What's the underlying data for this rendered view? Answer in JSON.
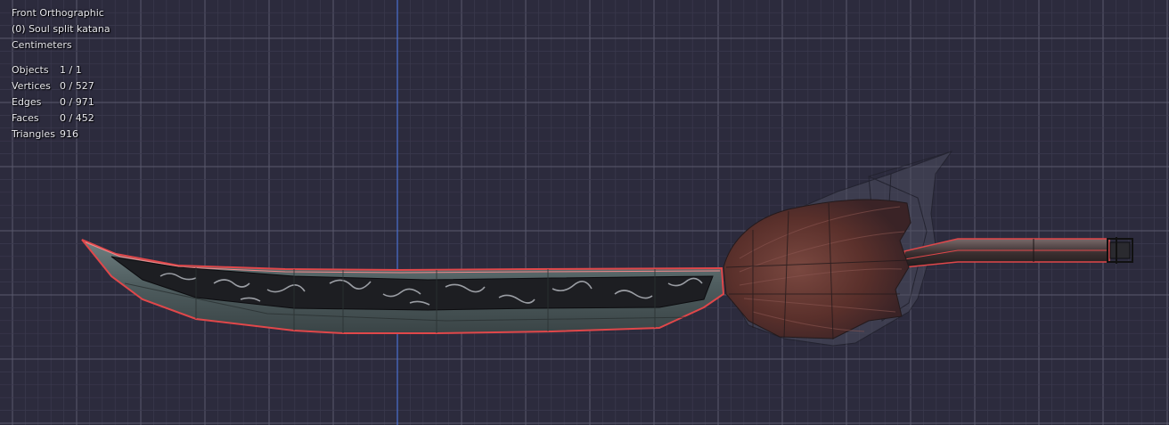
{
  "viewport": {
    "view_name": "Front Orthographic",
    "object_name": "(0) Soul split katana",
    "units": "Centimeters"
  },
  "stats": [
    {
      "label": "Objects",
      "value": "1 / 1"
    },
    {
      "label": "Vertices",
      "value": "0 / 527"
    },
    {
      "label": "Edges",
      "value": "0 / 971"
    },
    {
      "label": "Faces",
      "value": "0 / 452"
    },
    {
      "label": "Triangles",
      "value": "916"
    }
  ],
  "colors": {
    "background": "#2c2b3d",
    "grid_minor": "#3b3a4e",
    "grid_major": "#5a596d",
    "axis_z": "#4a6fd0",
    "selection_outline": "#e0474a",
    "hair": "#6b3b34",
    "blade": "#5a6a6c"
  }
}
